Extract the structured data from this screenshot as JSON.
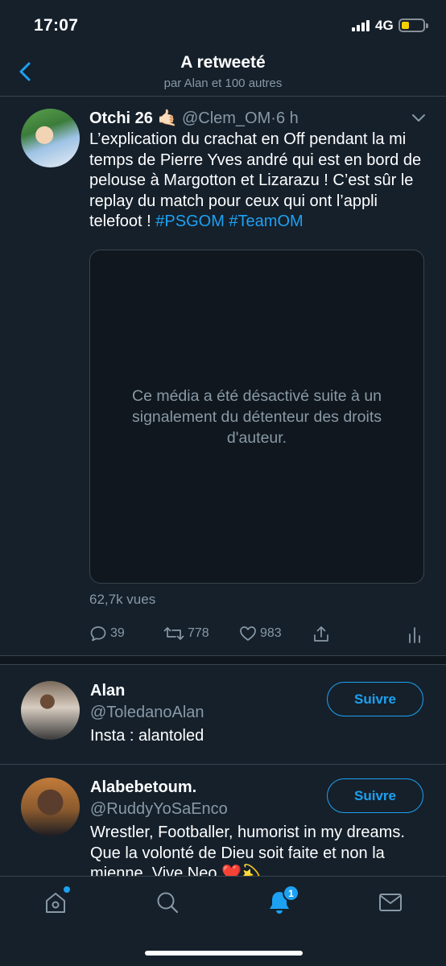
{
  "status_bar": {
    "time": "17:07",
    "network": "4G"
  },
  "header": {
    "title": "A retweeté",
    "subtitle": "par Alan et 100 autres"
  },
  "tweet": {
    "author_name": "Otchi 26",
    "author_emoji": "🤙🏻",
    "handle": "@Clem_OM",
    "separator": "·",
    "time": "6 h",
    "text": "L’explication du crachat en Off pendant la mi temps de Pierre Yves andré qui est en bord de pelouse à Margotton et Lizarazu ! C’est sûr le replay du match pour ceux qui ont l’appli telefoot !",
    "hashtag_1": "#PSGOM",
    "hashtag_2": "#TeamOM",
    "media_message": "Ce média a été désactivé suite à un signalement du détenteur des droits d'auteur.",
    "views": "62,7k vues",
    "replies": "39",
    "retweets": "778",
    "likes": "983"
  },
  "users": [
    {
      "name": "Alan",
      "handle": "@ToledanoAlan",
      "bio": "Insta : alantoled",
      "follow_label": "Suivre"
    },
    {
      "name": "Alabebetoum.",
      "handle": "@RuddyYoSaEnco",
      "bio": "Wrestler, Footballer, humorist in my dreams. Que la volonté de Dieu soit faite et non la mienne. Vive Neo ❤️💫",
      "follow_label": "Suivre"
    }
  ],
  "tab_bar": {
    "notifications_badge": "1"
  },
  "colors": {
    "background": "#15202b",
    "accent": "#1da1f2",
    "secondary_text": "#8899a6",
    "border": "#38444d"
  },
  "icons": [
    "back-chevron-icon",
    "caret-down-icon",
    "reply-icon",
    "retweet-icon",
    "like-icon",
    "share-icon",
    "analytics-icon",
    "home-icon",
    "search-icon",
    "notifications-icon",
    "messages-icon"
  ]
}
